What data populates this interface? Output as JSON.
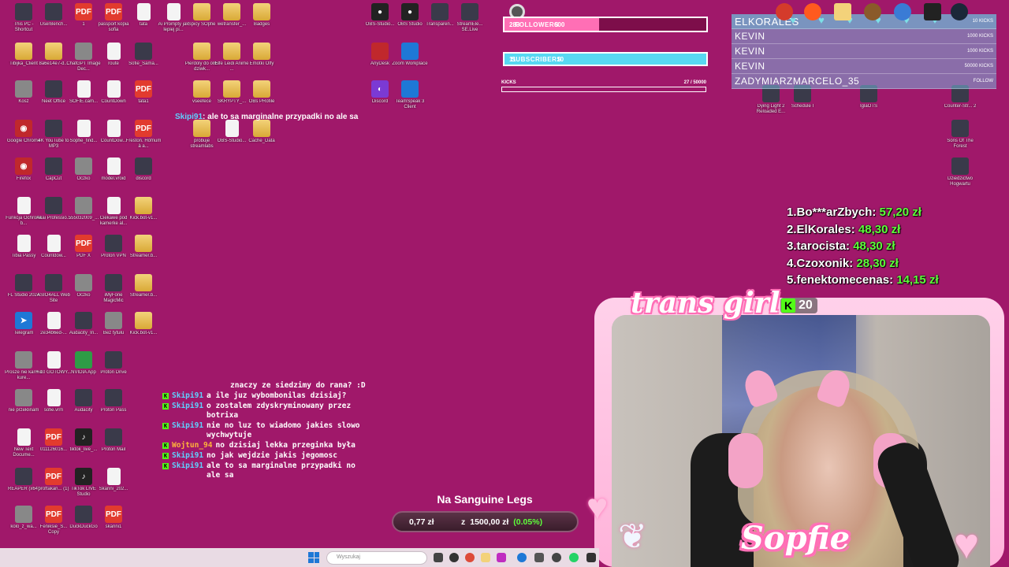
{
  "desktop": {
    "icons": [
      {
        "label": "This PC - Shortcut",
        "icon": "pc-icon"
      },
      {
        "label": "UserBench...",
        "icon": "gauge-icon"
      },
      {
        "label": "1",
        "icon": "pdf-icon"
      },
      {
        "label": "passport kopia sofia",
        "icon": "pdf-icon"
      },
      {
        "label": "tata",
        "icon": "file-icon"
      },
      {
        "label": "Ai Prompty jak lepiej pi...",
        "icon": "file-icon"
      },
      {
        "label": "Spicy SOpfie",
        "icon": "folder-icon"
      },
      {
        "label": "wetransfer_...",
        "icon": "folder-icon"
      },
      {
        "label": "Badges",
        "icon": "folder-icon"
      },
      {
        "label": "OBS-Studio...",
        "icon": "obs-icon"
      },
      {
        "label": "OBS Studio",
        "icon": "obs-icon"
      },
      {
        "label": "Transparen...",
        "icon": "app-icon"
      },
      {
        "label": "StreamEle... SE.Live",
        "icon": "streamelements-icon"
      },
      {
        "label": "Tibijka_Client",
        "icon": "folder-icon"
      },
      {
        "label": "8a6e14e7-d...",
        "icon": "folder-icon"
      },
      {
        "label": "ChatGPT Image Dec...",
        "icon": "image-icon"
      },
      {
        "label": "route",
        "icon": "file-icon"
      },
      {
        "label": "Sofie_Sama...",
        "icon": "app-icon"
      },
      {
        "label": "Pierdoly do o8S dziwk...",
        "icon": "folder-icon"
      },
      {
        "label": "Elfe Leidi Anime ...",
        "icon": "folder-icon"
      },
      {
        "label": "Emotki Olfy",
        "icon": "folder-icon"
      },
      {
        "label": "AnyDesk",
        "icon": "anydesk-icon"
      },
      {
        "label": "Zoom Workplace",
        "icon": "zoom-icon"
      },
      {
        "label": "Kosz",
        "icon": "recycle-bin-icon"
      },
      {
        "label": "Neet Office",
        "icon": "office-icon"
      },
      {
        "label": "SOFIE.cam...",
        "icon": "file-icon"
      },
      {
        "label": "CountDown",
        "icon": "file-icon"
      },
      {
        "label": "tata1",
        "icon": "pdf-icon"
      },
      {
        "label": "vseefece",
        "icon": "folder-icon"
      },
      {
        "label": "SKRYPTY_...",
        "icon": "folder-icon"
      },
      {
        "label": "OBs PRofile",
        "icon": "folder-icon"
      },
      {
        "label": "Discord",
        "icon": "discord-icon"
      },
      {
        "label": "TeamSpeak 3 Client",
        "icon": "teamspeak-icon"
      },
      {
        "label": "Google Chrome",
        "icon": "chrome-icon"
      },
      {
        "label": "4K YouTube to MP3",
        "icon": "cloud-icon"
      },
      {
        "label": "Sopfie_find...",
        "icon": "file-icon"
      },
      {
        "label": "CountDow...",
        "icon": "file-icon"
      },
      {
        "label": "Freston. Hófnum à a...",
        "icon": "pdf-icon"
      },
      {
        "label": "probuje streamlabs",
        "icon": "folder-icon"
      },
      {
        "label": "OBS-Studio...",
        "icon": "file-icon"
      },
      {
        "label": "Cache_Data",
        "icon": "folder-icon"
      },
      {
        "label": "Firefox",
        "icon": "firefox-icon"
      },
      {
        "label": "CapCut",
        "icon": "capcut-icon"
      },
      {
        "label": "Oczko",
        "icon": "image-icon"
      },
      {
        "label": "model.vroid",
        "icon": "file-icon"
      },
      {
        "label": "discord",
        "icon": "app-icon"
      },
      {
        "label": "Funkcja Ochrona b...",
        "icon": "file-icon"
      },
      {
        "label": "Akai Professio...",
        "icon": "app-icon"
      },
      {
        "label": "555032009_...",
        "icon": "image-icon"
      },
      {
        "label": "Ciekawe pod kamerke al...",
        "icon": "file-icon"
      },
      {
        "label": "Kick.bot-v1...",
        "icon": "folder-icon"
      },
      {
        "label": "Tibia Passy",
        "icon": "file-icon"
      },
      {
        "label": "Countdow...",
        "icon": "file-icon"
      },
      {
        "label": "PDF X",
        "icon": "pdf-icon"
      },
      {
        "label": "Proton VPN",
        "icon": "protonvpn-icon"
      },
      {
        "label": "Streamer.b...",
        "icon": "folder-icon"
      },
      {
        "label": "FL Studio 2024",
        "icon": "flstudio-icon"
      },
      {
        "label": "ASIO4ALL Web Site",
        "icon": "app-icon"
      },
      {
        "label": "Oczko",
        "icon": "image-icon"
      },
      {
        "label": "iMyFone MagicMic",
        "icon": "app-icon"
      },
      {
        "label": "Streamer.b...",
        "icon": "folder-icon"
      },
      {
        "label": "Telegram",
        "icon": "telegram-icon"
      },
      {
        "label": "2e34b6ed-...",
        "icon": "file-icon"
      },
      {
        "label": "Audacity_In...",
        "icon": "app-icon"
      },
      {
        "label": "Bez tytułu",
        "icon": "image-icon"
      },
      {
        "label": "Kick.bot-v1...",
        "icon": "folder-icon"
      },
      {
        "label": "Prosze nie karmic kure...",
        "icon": "image-icon"
      },
      {
        "label": "+ 10 GOTOWY...",
        "icon": "file-icon"
      },
      {
        "label": "NVIDIA App",
        "icon": "nvidia-icon"
      },
      {
        "label": "Proton Drive",
        "icon": "protondrive-icon"
      },
      {
        "label": "nie przeklinam",
        "icon": "image-icon"
      },
      {
        "label": "sofie.vrm",
        "icon": "file-icon"
      },
      {
        "label": "Audacity",
        "icon": "audacity-icon"
      },
      {
        "label": "Proton Pass",
        "icon": "protonpass-icon"
      },
      {
        "label": "New Text Docume...",
        "icon": "file-icon"
      },
      {
        "label": "011126016...",
        "icon": "pdf-icon"
      },
      {
        "label": "tiktok_live_...",
        "icon": "tiktok-icon"
      },
      {
        "label": "Proton Mail",
        "icon": "protonmail-icon"
      },
      {
        "label": "REAPER (x64)",
        "icon": "reaper-icon"
      },
      {
        "label": "proftakan... (1)",
        "icon": "pdf-icon"
      },
      {
        "label": "TikTok LIVE Studio",
        "icon": "tiktok-icon"
      },
      {
        "label": "Skanni_202...",
        "icon": "file-icon"
      },
      {
        "label": "kolo_z_wa...",
        "icon": "image-icon"
      },
      {
        "label": "Feniksie_S... Copy",
        "icon": "pdf-icon"
      },
      {
        "label": "DuckDuckGo",
        "icon": "duckduckgo-icon"
      },
      {
        "label": "skanni1",
        "icon": "pdf-icon"
      },
      {
        "label": "Dying Light 2 Reloaded E...",
        "icon": "game-icon"
      },
      {
        "label": "Schedule I",
        "icon": "game-icon"
      },
      {
        "label": "IglaOTS",
        "icon": "game-icon"
      },
      {
        "label": "Counter-Str... 2",
        "icon": "game-icon"
      },
      {
        "label": "Sons Of The Forest",
        "icon": "game-icon"
      },
      {
        "label": "Dziedzictwo Hogwartu",
        "icon": "game-icon"
      }
    ]
  },
  "goals": {
    "followers": {
      "current": "283",
      "label": "FOLLOWERS",
      "target": "600",
      "fraction": 0.47
    },
    "subscribers": {
      "current": "11",
      "label": "SUBSCRIBERS",
      "target": "10",
      "fraction": 1.0
    },
    "kicks": {
      "label": "KICKS",
      "value": "27  /  50000",
      "fraction": 0.0005
    }
  },
  "events": [
    {
      "name": "ELKORALES",
      "value": "10 KICKS"
    },
    {
      "name": "KEVIN",
      "value": "1000 KICKS"
    },
    {
      "name": "KEVIN",
      "value": "1000 KICKS"
    },
    {
      "name": "KEVIN",
      "value": "50000 KICKS"
    },
    {
      "name": "ZADYMIARZMARCELO_35",
      "value": "FOLLOW"
    }
  ],
  "leaderboard": [
    {
      "rank": "1.",
      "name": "Bo***arZbych:",
      "amount": "57,20 zł"
    },
    {
      "rank": "2.",
      "name": "ElKorales:",
      "amount": "48,30 zł"
    },
    {
      "rank": "3.",
      "name": "tarocista:",
      "amount": "48,30 zł"
    },
    {
      "rank": "4.",
      "name": "Czoxonik:",
      "amount": "28,30 zł"
    },
    {
      "rank": "5.",
      "name": "fenektomecenas:",
      "amount": "14,15 zł"
    }
  ],
  "camera": {
    "label": "trans girl",
    "kick_count": "20",
    "name": "Sopfie"
  },
  "chat_overlay_top": {
    "user": "Skipi91",
    "text": ": ale to sa marginalne przypadki no ale sa"
  },
  "chat": [
    {
      "user": "",
      "text": "znaczy ze siedzimy do rana? :D",
      "badge": false
    },
    {
      "user": "Skipi91",
      "text": "a ile juz wybombonilas dzisiaj?",
      "badge": true
    },
    {
      "user": "Skipi91",
      "text": "o zostalem zdyskryminowany przez botrixa",
      "badge": true
    },
    {
      "user": "Skipi91",
      "text": "nie no luz to wiadomo jakies slowo wychwytuje",
      "badge": true
    },
    {
      "user": "Wojtun_94",
      "text": "no dzisiaj lekka przeginka była",
      "badge": true
    },
    {
      "user": "Skipi91",
      "text": "no jak wejdzie jakis jegomosc",
      "badge": true
    },
    {
      "user": "Skipi91",
      "text": "ale to sa marginalne przypadki no ale sa",
      "badge": true
    }
  ],
  "prediction": {
    "title": "Na Sanguine Legs",
    "left": "0,77 zł",
    "currency": "z",
    "right": "1500,00 zł",
    "percent": "(0.05%)"
  },
  "taskbar": {
    "search_placeholder": "Wyszukaj"
  },
  "colors": {
    "background": "#a0186a",
    "followers": "#ff6fb5",
    "subscribers": "#58d8f2",
    "kick_green": "#53fc18",
    "amount_green": "#5dff3a"
  }
}
